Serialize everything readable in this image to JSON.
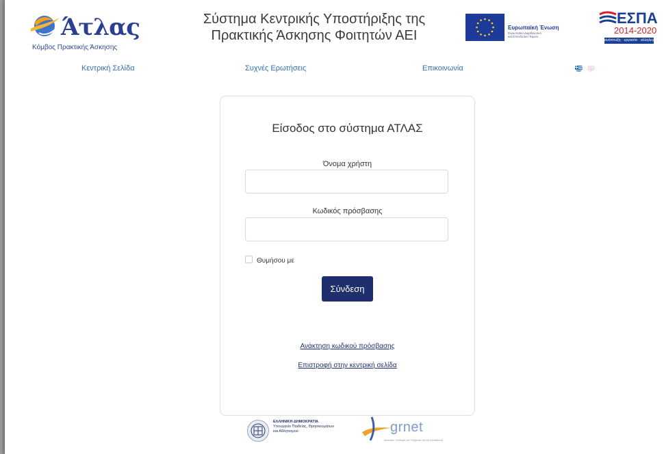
{
  "header": {
    "logo_word": "Άτλας",
    "logo_sub": "Κόμβος Πρακτικής Άσκησης",
    "title_line1": "Σύστημα Κεντρικής Υποστήριξης της",
    "title_line2": "Πρακτικής Άσκησης Φοιτητών ΑΕΙ",
    "eu_title": "Ευρωπαϊκή Ένωση",
    "eu_sub1": "Ευρωπαϊκό Διαρθρωτικό",
    "eu_sub2": "και Επενδυτικό Ταμείο",
    "espa_word": "ΕΣΠΑ",
    "espa_years": "2014-2020",
    "espa_tagline": "ανάπτυξη · εργασία · αλληλεγγύη"
  },
  "nav": {
    "home": "Κεντρική Σελίδα",
    "faq": "Συχνές Ερωτήσεις",
    "contact": "Επικοινωνία"
  },
  "login": {
    "title": "Είσοδος στο σύστημα ΑΤΛΑΣ",
    "username_label": "Όνομα χρήστη",
    "username_value": "",
    "password_label": "Κωδικός πρόσβασης",
    "password_value": "",
    "remember_label": "Θυμήσου με",
    "submit_label": "Σύνδεση",
    "recover_link": "Ανάκτηση κωδικού πρόσβασης",
    "back_link": "Επιστροφή στην κεντρική σελίδα"
  },
  "footer": {
    "gov_line1": "ΕΛΛΗΝΙΚΗ ΔΗΜΟΚΡΑΤΙΑ",
    "gov_line2": "Υπουργείο Παιδείας, Θρησκευμάτων",
    "gov_line3": "και Αθλητισμού",
    "grnet_word": "grnet",
    "grnet_sub": "Δικτυακές Υποδομές και Υπηρεσίες για την Εκπαίδευση"
  },
  "colors": {
    "primary": "#1e2f6c",
    "link": "#2f6fb7",
    "brand_blue": "#2a3f8f",
    "espa_red": "#d51e2b"
  },
  "icons": [
    "atlas-logo-icon",
    "eu-flag-icon",
    "espa-logo-icon",
    "greek-flag-icon",
    "uk-flag-icon",
    "greek-seal-icon",
    "grnet-logo-icon"
  ]
}
